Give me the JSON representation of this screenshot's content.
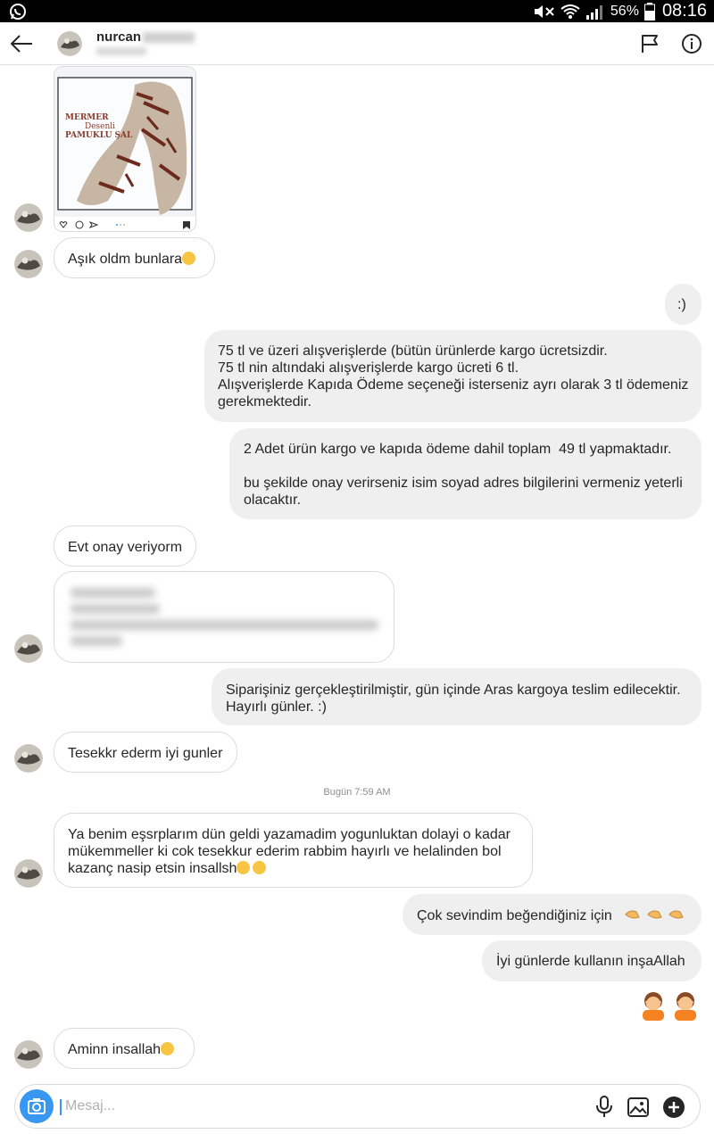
{
  "status_bar": {
    "battery_percent": "56%",
    "time": "08:16"
  },
  "header": {
    "contact_name": "nurcan"
  },
  "shared_post": {
    "title_line1": "MERMER",
    "title_line2": "Desenli",
    "title_line3": "PAMUKLU ŞAL"
  },
  "messages": [
    {
      "side": "in",
      "text": "Aşık oldm bunlara"
    },
    {
      "side": "out",
      "text": ":)"
    },
    {
      "side": "out",
      "text": "75 tl ve üzeri alışverişlerde (bütün ürünlerde kargo ücretsizdir.\n75 tl nin altındaki alışverişlerde kargo ücreti 6 tl.\nAlışverişlerde Kapıda Ödeme seçeneği isterseniz ayrı olarak 3 tl ödemeniz gerekmektedir."
    },
    {
      "side": "out",
      "text": "2 Adet ürün kargo ve kapıda ödeme dahil toplam  49 tl yapmaktadır.\n\nbu şekilde onay verirseniz isim soyad adres bilgilerini vermeniz yeterli olacaktır."
    },
    {
      "side": "in",
      "text": "Evt onay veriyorm"
    },
    {
      "side": "out",
      "text": "Siparişiniz gerçekleştirilmiştir, gün içinde Aras kargoya teslim edilecektir. Hayırlı günler. :)"
    },
    {
      "side": "in",
      "text": "Tesekkr ederm iyi gunler"
    },
    {
      "side": "in",
      "text": "Ya benim eşsrplarım dün geldi yazamadim yogunluktan dolayi o kadar mükemmeller ki cok tesekkur ederim rabbim hayırlı ve helalinden bol kazanç nasip etsin insallsh"
    },
    {
      "side": "out",
      "text": "Çok sevindim  beğendiğiniz için"
    },
    {
      "side": "out",
      "text": "İyi günlerde kullanın inşaAllah"
    },
    {
      "side": "in",
      "text": "Aminn insallah"
    }
  ],
  "timestamp": "Bugün 7:59 AM",
  "composer": {
    "placeholder": "Mesaj..."
  },
  "colors": {
    "accent": "#3897f0",
    "incoming_border": "#dbdbdb",
    "outgoing_bg": "#efefef"
  },
  "icons": [
    "whatsapp-icon",
    "mute-icon",
    "wifi-icon",
    "signal-icon",
    "battery-icon",
    "back-arrow-icon",
    "flag-icon",
    "info-icon",
    "camera-icon",
    "microphone-icon",
    "gallery-icon",
    "plus-icon"
  ]
}
